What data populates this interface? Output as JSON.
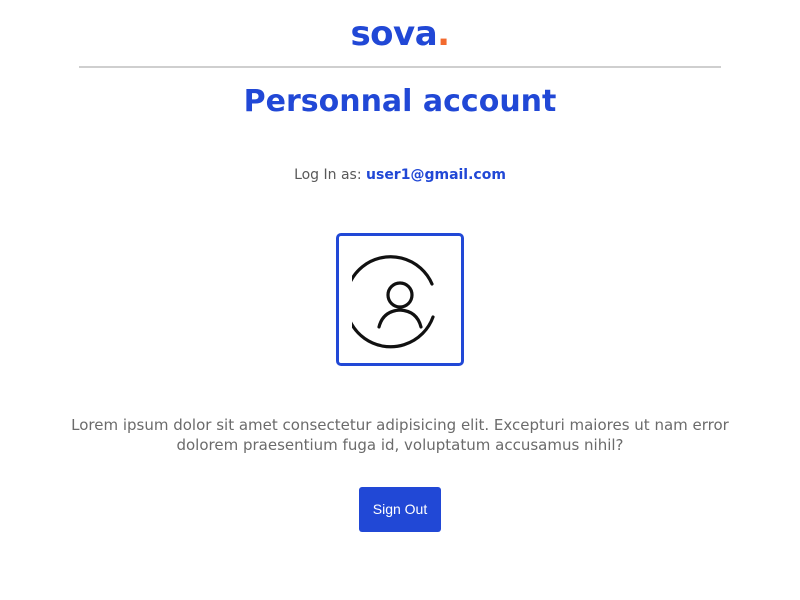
{
  "brand": {
    "logo_word": "sova",
    "logo_dot": ".",
    "primary_color": "#2148d6",
    "accent_color": "#f26a2e"
  },
  "page": {
    "title": "Personnal account"
  },
  "account": {
    "login_label": "Log In as:",
    "email": "user1@gmail.com",
    "avatar_icon": "user-circle-icon"
  },
  "content": {
    "description": "Lorem ipsum dolor sit amet consectetur adipisicing elit. Excepturi maiores ut nam error dolorem praesentium fuga id, voluptatum accusamus nihil?"
  },
  "actions": {
    "sign_out_label": "Sign Out"
  }
}
